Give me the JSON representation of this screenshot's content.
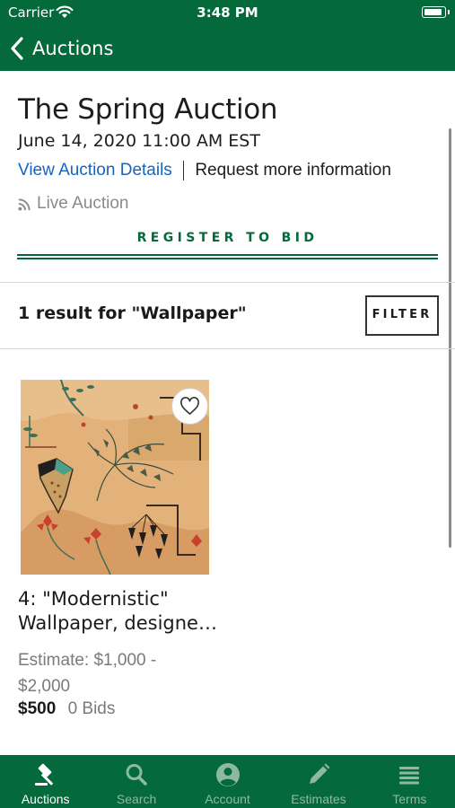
{
  "status_bar": {
    "carrier": "Carrier",
    "time": "3:48 PM",
    "battery_level": 0.95
  },
  "nav": {
    "back_label": "Auctions"
  },
  "auction": {
    "title": "The Spring Auction",
    "date": "June 14, 2020 11:00 AM EST",
    "details_link": "View Auction Details",
    "request_link": "Request more information",
    "live_label": "Live Auction",
    "register_label": "REGISTER TO BID"
  },
  "results": {
    "summary": "1 result for \"Wallpaper\"",
    "filter_label": "FILTER"
  },
  "lots": [
    {
      "title_line1": "4: \"Modernistic\"",
      "title_line2": "Wallpaper, designe…",
      "estimate_line1": "Estimate: $1,000 -",
      "estimate_line2": "$2,000",
      "price": "$500",
      "bids": "0 Bids"
    }
  ],
  "tabs": [
    {
      "label": "Auctions",
      "icon": "gavel-icon",
      "active": true
    },
    {
      "label": "Search",
      "icon": "search-icon",
      "active": false
    },
    {
      "label": "Account",
      "icon": "account-icon",
      "active": false
    },
    {
      "label": "Estimates",
      "icon": "pencil-icon",
      "active": false
    },
    {
      "label": "Terms",
      "icon": "list-icon",
      "active": false
    }
  ],
  "colors": {
    "brand_green": "#046a3c",
    "link_blue": "#1565c0",
    "muted_gray": "#8a8a8a",
    "tab_inactive": "#8fb8a2"
  }
}
